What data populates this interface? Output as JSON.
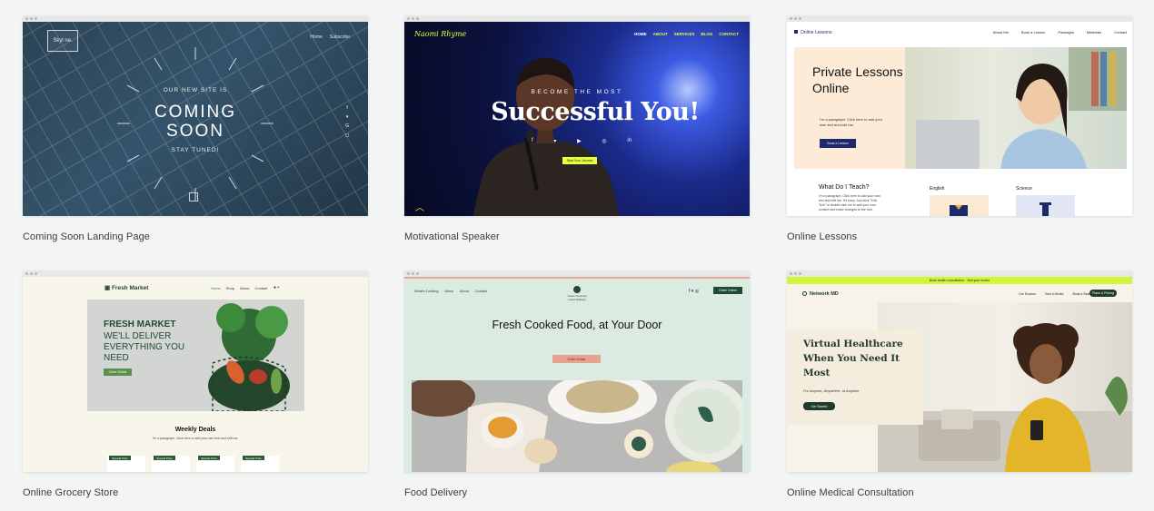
{
  "templates": [
    {
      "caption": "Coming Soon Landing Page",
      "logo": "Skyl ne.",
      "nav": [
        "Home",
        "Subscribe"
      ],
      "pre": "OUR NEW SITE IS",
      "headline_1": "COMING",
      "headline_2": "SOON",
      "post": "STAY TUNED!",
      "social_icons": [
        "facebook-icon",
        "twitter-icon",
        "google-plus-icon",
        "instagram-icon"
      ]
    },
    {
      "caption": "Motivational Speaker",
      "brand": "Naomi Rhyme",
      "nav": [
        "HOME",
        "ABOUT",
        "SERVICES",
        "BLOG",
        "CONTACT"
      ],
      "pre": "BECOME THE MOST",
      "headline": "Successful You!",
      "cta": "Start Your Journey",
      "social_icons": [
        "facebook-icon",
        "twitter-icon",
        "youtube-icon",
        "instagram-icon",
        "linkedin-icon"
      ],
      "accent": "#e4ff3b"
    },
    {
      "caption": "Online Lessons",
      "brand": "Online Lessons",
      "nav": [
        "About Me",
        "Book a Lesson",
        "Packages",
        "Materials",
        "Contact"
      ],
      "hero_title": "Private Lessons Online",
      "hero_text": "I'm a paragraph. Click here to add your own text and edit me.",
      "hero_button": "Book a Lesson",
      "section_title": "What Do I Teach?",
      "section_text": "I'm a paragraph. Click here to add your own text and edit me. It's easy. Just click \"Edit Text\" or double click me to add your own content and make changes to the font.",
      "subjects": [
        "English",
        "Science"
      ],
      "accent": "#1c2a6b"
    },
    {
      "caption": "Online Grocery Store",
      "brand": "Fresh Market",
      "nav": [
        "Home",
        "Shop",
        "About",
        "Contact"
      ],
      "hero_title": "FRESH MARKET",
      "hero_sub": "WE'LL DELIVER EVERYTHING YOU NEED",
      "hero_button": "Order Online",
      "section_title": "Weekly Deals",
      "section_text": "I'm a paragraph. Click here to add your own text and edit me.",
      "product_tags": [
        "Special Price",
        "Special Price",
        "Special Price",
        "Special Price"
      ],
      "accent": "#1f4a36"
    },
    {
      "caption": "Food Delivery",
      "nav": [
        "What's Cooking",
        "Menu",
        "About",
        "Contact"
      ],
      "logo_text": "Green Gourmet Lunch Delivery",
      "order_button": "Order Online",
      "headline": "Fresh Cooked Food, at Your Door",
      "cta": "Order Online",
      "accent": "#1f4a36"
    },
    {
      "caption": "Online Medical Consultation",
      "banner": "Book health consultation - Visit your doctor",
      "brand": "Network MD",
      "nav": [
        "Our Doctors",
        "How it Works",
        "Book a Session"
      ],
      "plans_button": "Plans & Pricing",
      "headline": "Virtual Healthcare When You Need It Most",
      "sub": "For Anyone, Anywhere, at Anytime",
      "cta": "Get Started",
      "accent": "#d4f43a"
    }
  ]
}
